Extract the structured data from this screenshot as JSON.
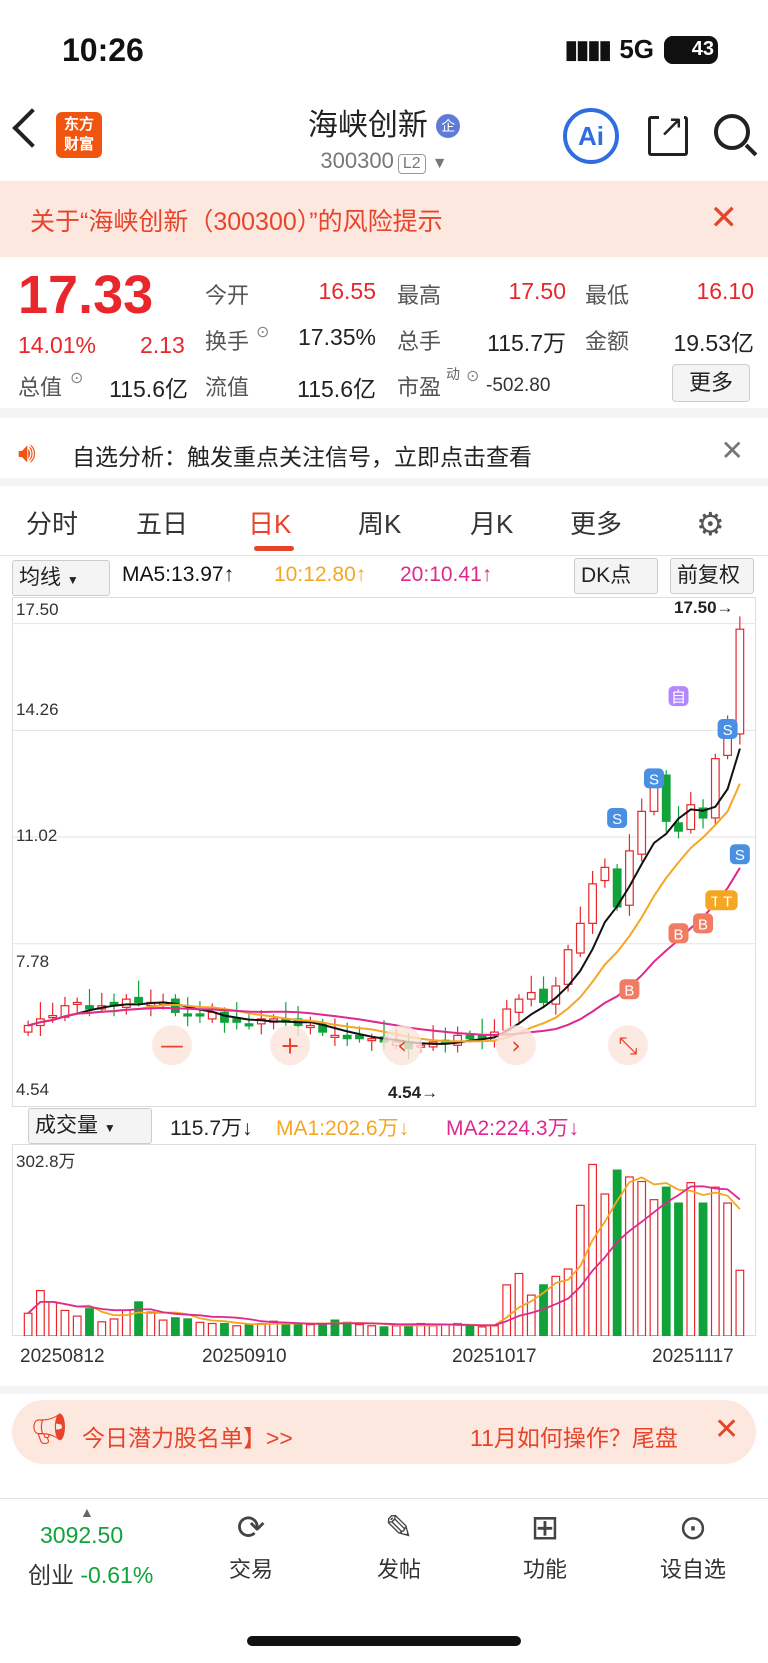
{
  "status": {
    "time": "10:26",
    "network": "5G",
    "battery": "43"
  },
  "header": {
    "logo": "东方\n财富",
    "title": "海峡创新",
    "code": "300300",
    "level": "L2",
    "ai": "Ai"
  },
  "risk_banner": {
    "text": "关于“海峡创新（300300）”的风险提示",
    "close": "✕"
  },
  "quote": {
    "price": "17.33",
    "change_pct": "14.01%",
    "change": "2.13",
    "open_label": "今开",
    "open": "16.55",
    "high_label": "最高",
    "high": "17.50",
    "low_label": "最低",
    "low": "16.10",
    "turnover_label": "换手",
    "turnover": "17.35%",
    "volume_label": "总手",
    "volume": "115.7万",
    "amount_label": "金额",
    "amount": "19.53亿",
    "mktcap_label": "总值",
    "mktcap": "115.6亿",
    "float_label": "流值",
    "float_cap": "115.6亿",
    "pe_label": "市盈",
    "pe_sup": "动",
    "pe": "-502.80",
    "more": "更多"
  },
  "analysis": {
    "text": "自选分析：触发重点关注信号，立即点击查看",
    "close": "✕"
  },
  "tabs": [
    "分时",
    "五日",
    "日K",
    "周K",
    "月K",
    "更多"
  ],
  "active_tab": "日K",
  "chart_toolbar": {
    "ma_select": "均线",
    "ma5": "MA5:13.97↑",
    "ma10": "10:12.80↑",
    "ma20": "20:10.41↑",
    "dk": "DK点",
    "adjust": "前复权"
  },
  "volume_toolbar": {
    "select": "成交量",
    "vol": "115.7万↓",
    "ma1": "MA1:202.6万↓",
    "ma2": "MA2:224.3万↓"
  },
  "promo": {
    "text": "今日潜力股名单】>>",
    "text2": "11月如何操作？尾盘",
    "close": "✕"
  },
  "bottom_nav": {
    "index_value": "3092.50",
    "index_name": "创业",
    "index_change": "-0.61%",
    "items": [
      "交易",
      "发帖",
      "功能",
      "设自选"
    ]
  },
  "colors": {
    "up": "#e8262b",
    "down": "#11a23a",
    "ma5": "#111111",
    "ma10": "#f5a623",
    "ma20": "#e0288f",
    "accent": "#e8442b"
  },
  "chart_data": {
    "type": "candlestick",
    "y_ticks": [
      "17.50",
      "14.26",
      "11.02",
      "7.78",
      "4.54"
    ],
    "ylim": [
      4.54,
      17.5
    ],
    "high_label": "17.50→",
    "low_label": "4.54→",
    "x_labels": [
      "20250812",
      "20250910",
      "20251017",
      "20251117"
    ],
    "volume_max_label": "302.8万",
    "signals": [
      "S",
      "S",
      "S",
      "S",
      "B",
      "B",
      "B",
      "T",
      "T",
      "自"
    ],
    "closes": [
      5.3,
      5.5,
      5.6,
      5.9,
      6.0,
      5.8,
      5.9,
      5.9,
      6.1,
      6.0,
      6.0,
      6.0,
      5.7,
      5.6,
      5.6,
      5.7,
      5.4,
      5.4,
      5.3,
      5.5,
      5.5,
      5.4,
      5.3,
      5.3,
      5.1,
      5.0,
      4.9,
      4.9,
      4.9,
      4.8,
      4.8,
      4.6,
      4.7,
      4.8,
      4.8,
      5.0,
      4.9,
      4.9,
      5.1,
      5.8,
      6.1,
      6.3,
      6.0,
      6.5,
      7.6,
      8.4,
      9.6,
      10.1,
      8.9,
      10.6,
      11.8,
      12.8,
      11.5,
      11.2,
      12.0,
      11.6,
      13.4,
      14.2,
      17.33
    ],
    "volumes": [
      40,
      80,
      60,
      45,
      35,
      48,
      25,
      30,
      45,
      60,
      42,
      28,
      32,
      30,
      24,
      22,
      22,
      18,
      20,
      22,
      26,
      22,
      20,
      20,
      22,
      28,
      24,
      20,
      18,
      16,
      18,
      20,
      22,
      18,
      20,
      22,
      18,
      16,
      18,
      90,
      110,
      72,
      90,
      105,
      118,
      230,
      302,
      250,
      292,
      280,
      272,
      240,
      262,
      234,
      270,
      234,
      262,
      234,
      115.7
    ]
  }
}
